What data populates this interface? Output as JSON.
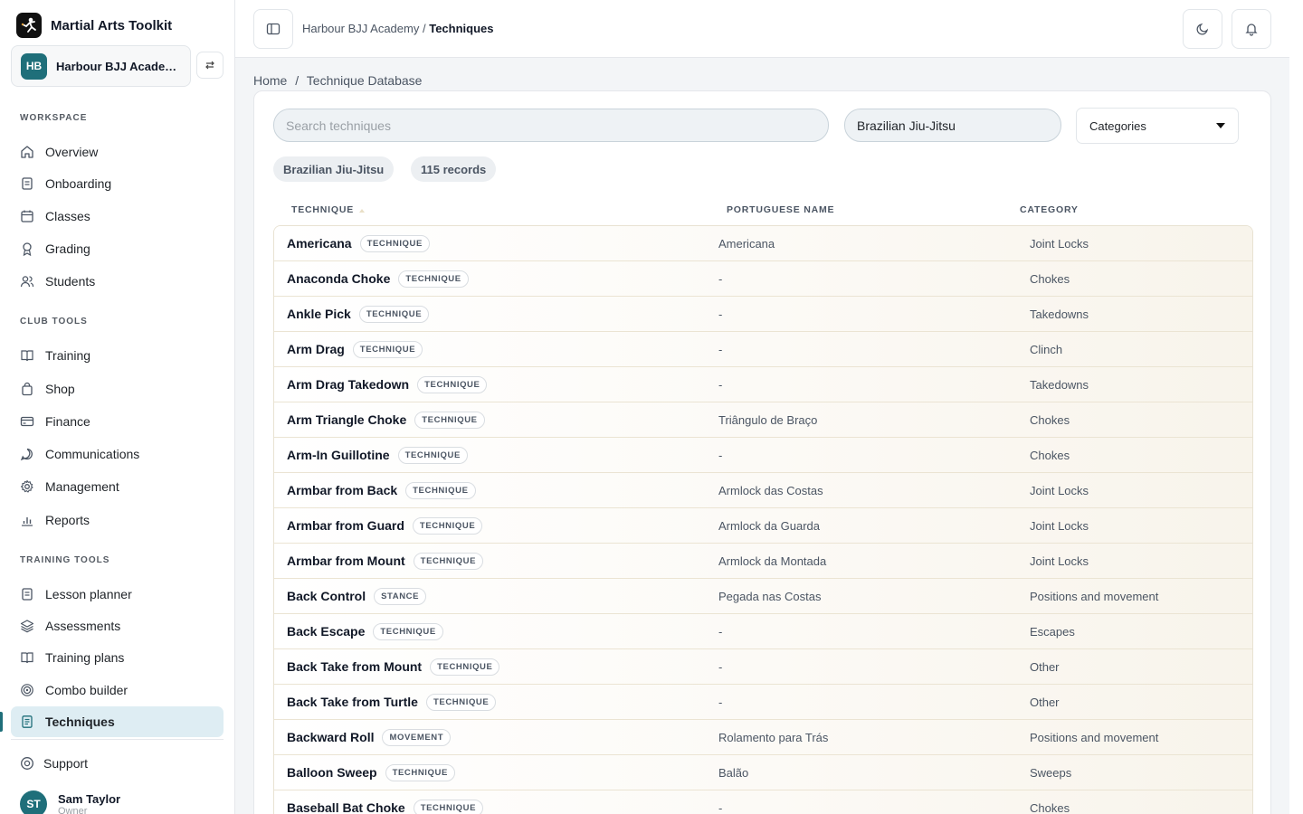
{
  "app": {
    "name": "Martial Arts Toolkit"
  },
  "org": {
    "initials": "HB",
    "name": "Harbour BJJ Academy"
  },
  "sidebar": {
    "workspace_title": "WORKSPACE",
    "workspace": [
      {
        "label": "Overview",
        "icon": "home-icon"
      },
      {
        "label": "Onboarding",
        "icon": "clipboard-icon"
      },
      {
        "label": "Classes",
        "icon": "calendar-icon"
      },
      {
        "label": "Grading",
        "icon": "award-icon"
      },
      {
        "label": "Students",
        "icon": "users-icon"
      }
    ],
    "club_title": "CLUB TOOLS",
    "club": [
      {
        "label": "Training",
        "icon": "book-icon"
      },
      {
        "label": "Shop",
        "icon": "shopping-bag-icon"
      },
      {
        "label": "Finance",
        "icon": "credit-card-icon"
      },
      {
        "label": "Communications",
        "icon": "message-icon"
      },
      {
        "label": "Management",
        "icon": "gear-icon"
      },
      {
        "label": "Reports",
        "icon": "bar-chart-icon"
      }
    ],
    "training_title": "TRAINING TOOLS",
    "training": [
      {
        "label": "Lesson planner",
        "icon": "clipboard-icon"
      },
      {
        "label": "Assessments",
        "icon": "layers-icon"
      },
      {
        "label": "Training plans",
        "icon": "book-icon"
      },
      {
        "label": "Combo builder",
        "icon": "target-icon"
      },
      {
        "label": "Techniques",
        "icon": "document-icon",
        "active": true
      }
    ],
    "support_label": "Support",
    "user": {
      "initials": "ST",
      "name": "Sam Taylor",
      "role": "Owner"
    }
  },
  "topbar": {
    "crumb_org": "Harbour BJJ Academy",
    "crumb_sep": "/",
    "crumb_current": "Techniques"
  },
  "page": {
    "crumb_home": "Home",
    "crumb_sep": "/",
    "crumb_current": "Technique Database"
  },
  "filters": {
    "search_placeholder": "Search techniques",
    "discipline": "Brazilian Jiu-Jitsu",
    "categories_label": "Categories"
  },
  "chips": {
    "discipline": "Brazilian Jiu-Jitsu",
    "count": "115 records"
  },
  "table": {
    "headers": {
      "technique": "TECHNIQUE",
      "portuguese": "PORTUGUESE NAME",
      "category": "CATEGORY"
    },
    "rows": [
      {
        "name": "Americana",
        "type": "TECHNIQUE",
        "pt": "Americana",
        "category": "Joint Locks"
      },
      {
        "name": "Anaconda Choke",
        "type": "TECHNIQUE",
        "pt": "-",
        "category": "Chokes"
      },
      {
        "name": "Ankle Pick",
        "type": "TECHNIQUE",
        "pt": "-",
        "category": "Takedowns"
      },
      {
        "name": "Arm Drag",
        "type": "TECHNIQUE",
        "pt": "-",
        "category": "Clinch"
      },
      {
        "name": "Arm Drag Takedown",
        "type": "TECHNIQUE",
        "pt": "-",
        "category": "Takedowns"
      },
      {
        "name": "Arm Triangle Choke",
        "type": "TECHNIQUE",
        "pt": "Triângulo de Braço",
        "category": "Chokes"
      },
      {
        "name": "Arm-In Guillotine",
        "type": "TECHNIQUE",
        "pt": "-",
        "category": "Chokes"
      },
      {
        "name": "Armbar from Back",
        "type": "TECHNIQUE",
        "pt": "Armlock das Costas",
        "category": "Joint Locks"
      },
      {
        "name": "Armbar from Guard",
        "type": "TECHNIQUE",
        "pt": "Armlock da Guarda",
        "category": "Joint Locks"
      },
      {
        "name": "Armbar from Mount",
        "type": "TECHNIQUE",
        "pt": "Armlock da Montada",
        "category": "Joint Locks"
      },
      {
        "name": "Back Control",
        "type": "STANCE",
        "pt": "Pegada nas Costas",
        "category": "Positions and movement"
      },
      {
        "name": "Back Escape",
        "type": "TECHNIQUE",
        "pt": "-",
        "category": "Escapes"
      },
      {
        "name": "Back Take from Mount",
        "type": "TECHNIQUE",
        "pt": "-",
        "category": "Other"
      },
      {
        "name": "Back Take from Turtle",
        "type": "TECHNIQUE",
        "pt": "-",
        "category": "Other"
      },
      {
        "name": "Backward Roll",
        "type": "MOVEMENT",
        "pt": "Rolamento para Trás",
        "category": "Positions and movement"
      },
      {
        "name": "Balloon Sweep",
        "type": "TECHNIQUE",
        "pt": "Balão",
        "category": "Sweeps"
      },
      {
        "name": "Baseball Bat Choke",
        "type": "TECHNIQUE",
        "pt": "-",
        "category": "Chokes"
      }
    ]
  },
  "colors": {
    "accent": "#1f6f7a",
    "active_bg": "#deedf3"
  }
}
